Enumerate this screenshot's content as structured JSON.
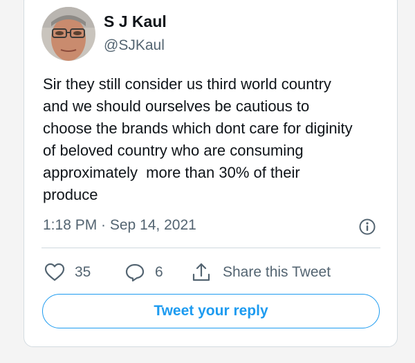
{
  "author": {
    "display_name": "S J Kaul",
    "handle": "@SJKaul"
  },
  "tweet": {
    "lines": [
      "Sir they still consider us third world country",
      "and we should ourselves be cautious to",
      "choose the brands which dont care for diginity",
      "of beloved country who are consuming",
      "approximately  more than 30% of their",
      "produce"
    ],
    "timestamp": "1:18 PM · Sep 14, 2021"
  },
  "actions": {
    "likes_count": "35",
    "replies_count": "6",
    "share_label": "Share this Tweet"
  },
  "reply_button_label": "Tweet your reply",
  "colors": {
    "accent": "#1d9bf0",
    "text_primary": "#0f1419",
    "text_secondary": "#536471",
    "divider": "#cfd9de"
  },
  "icons": [
    "info-icon",
    "heart-icon",
    "reply-icon",
    "share-icon"
  ]
}
